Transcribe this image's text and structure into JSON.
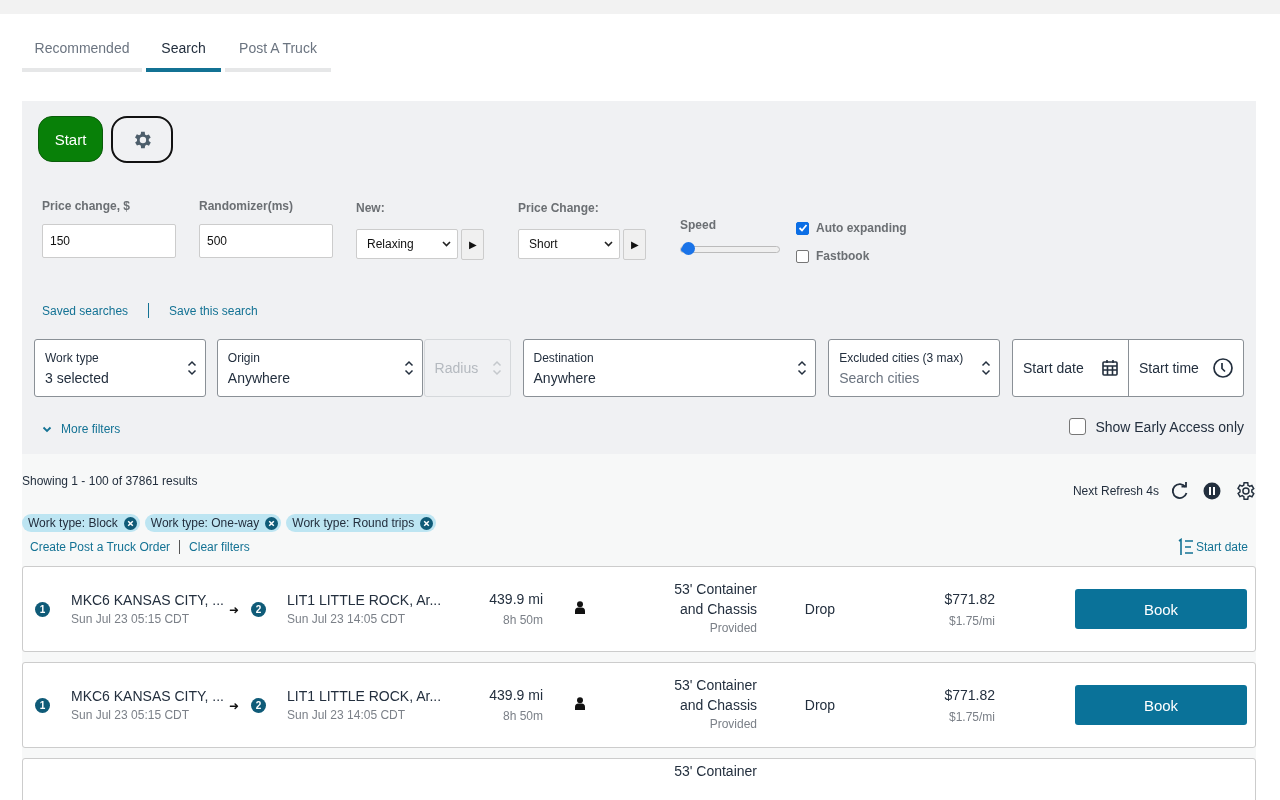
{
  "tabs": [
    {
      "label": "Recommended",
      "selected": false
    },
    {
      "label": "Search",
      "selected": true
    },
    {
      "label": "Post A Truck",
      "selected": false
    }
  ],
  "controls": {
    "start_button": "Start",
    "fields": [
      {
        "label": "Price change, $",
        "value": "150"
      },
      {
        "label": "Randomizer(ms)",
        "value": "500"
      }
    ],
    "selects": [
      {
        "label": "New:",
        "value": "Relaxing",
        "play": "▶"
      },
      {
        "label": "Price Change:",
        "value": "Short",
        "play": "▶"
      }
    ],
    "speed": {
      "label": "Speed",
      "level": 0.08
    },
    "options": [
      {
        "label": "Auto expanding",
        "checked": true
      },
      {
        "label": "Fastbook",
        "checked": false
      }
    ]
  },
  "saved_links": [
    "Saved searches",
    "Save this search"
  ],
  "filters": [
    {
      "kind": "select",
      "label": "Work type",
      "value": "3 selected",
      "disabled": false
    },
    {
      "kind": "select",
      "label": "Origin",
      "value": "Anywhere",
      "disabled": false
    },
    {
      "kind": "select",
      "label": "Radius",
      "disabled": true
    },
    {
      "kind": "select",
      "label": "Destination",
      "value": "Anywhere",
      "disabled": false
    },
    {
      "kind": "search",
      "label": "Excluded cities (3 max)",
      "placeholder": "Search cities",
      "disabled": false
    }
  ],
  "date_fields": [
    {
      "kind": "date",
      "label": "Start date"
    },
    {
      "kind": "time",
      "label": "Start time"
    }
  ],
  "more_filters": "More filters",
  "early_access": {
    "label": "Show Early Access only",
    "checked": false
  },
  "results": {
    "summary": "Showing 1 - 100 of 37861 results",
    "refresh": "Next Refresh 4s",
    "chips": [
      "Work type: Block",
      "Work type: One-way",
      "Work type: Round trips"
    ],
    "links": [
      "Create Post a Truck Order",
      "Clear filters"
    ],
    "sort": "Start date"
  },
  "loads": [
    {
      "stop1": "1",
      "origin": "MKC6 KANSAS CITY, ...",
      "origin_time": "Sun Jul 23 05:15 CDT",
      "arrow": "➜",
      "stop2": "2",
      "destination": "LIT1 LITTLE ROCK, Ar...",
      "destination_time": "Sun Jul 23 14:05 CDT",
      "distance": "439.9 mi",
      "duration": "8h 50m",
      "equipment": [
        "53' Container",
        "and Chassis"
      ],
      "equipment_note": "Provided",
      "trailer": "Drop",
      "price": "$771.82",
      "rate": "$1.75/mi",
      "button": "Book"
    },
    {
      "stop1": "1",
      "origin": "MKC6 KANSAS CITY, ...",
      "origin_time": "Sun Jul 23 05:15 CDT",
      "arrow": "➜",
      "stop2": "2",
      "destination": "LIT1 LITTLE ROCK, Ar...",
      "destination_time": "Sun Jul 23 14:05 CDT",
      "distance": "439.9 mi",
      "duration": "8h 50m",
      "equipment": [
        "53' Container",
        "and Chassis"
      ],
      "equipment_note": "Provided",
      "trailer": "Drop",
      "price": "$771.82",
      "rate": "$1.75/mi",
      "button": "Book"
    },
    {
      "equipment": [
        "53' Container"
      ]
    }
  ]
}
